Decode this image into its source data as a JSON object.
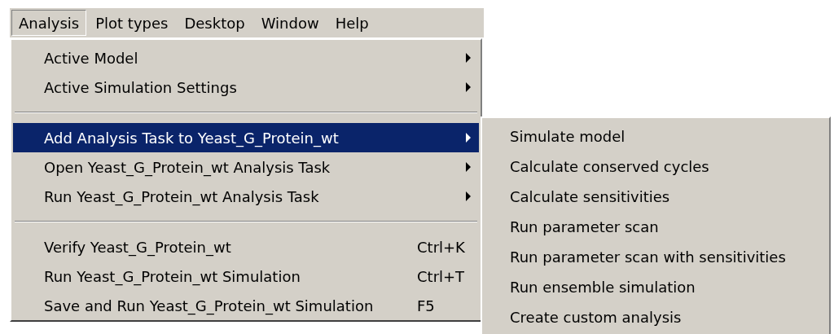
{
  "menubar": [
    {
      "label": "Analysis",
      "selected": true
    },
    {
      "label": "Plot types",
      "selected": false
    },
    {
      "label": "Desktop",
      "selected": false
    },
    {
      "label": "Window",
      "selected": false
    },
    {
      "label": "Help",
      "selected": false
    }
  ],
  "menu": {
    "groups": [
      [
        {
          "label": "Active Model",
          "submenu": true,
          "selected": false
        },
        {
          "label": "Active Simulation Settings",
          "submenu": true,
          "selected": false
        }
      ],
      [
        {
          "label": "Add Analysis Task to Yeast_G_Protein_wt",
          "submenu": true,
          "selected": true
        },
        {
          "label": "Open Yeast_G_Protein_wt Analysis Task",
          "submenu": true,
          "selected": false
        },
        {
          "label": "Run Yeast_G_Protein_wt Analysis Task",
          "submenu": true,
          "selected": false
        }
      ],
      [
        {
          "label": "Verify Yeast_G_Protein_wt",
          "shortcut": "Ctrl+K",
          "submenu": false,
          "selected": false
        },
        {
          "label": "Run Yeast_G_Protein_wt Simulation",
          "shortcut": "Ctrl+T",
          "submenu": false,
          "selected": false
        },
        {
          "label": "Save and Run Yeast_G_Protein_wt Simulation",
          "shortcut": "F5",
          "submenu": false,
          "selected": false
        }
      ]
    ]
  },
  "submenu": {
    "items": [
      {
        "label": "Simulate model"
      },
      {
        "label": "Calculate conserved cycles"
      },
      {
        "label": "Calculate sensitivities"
      },
      {
        "label": "Run parameter scan"
      },
      {
        "label": "Run parameter scan with sensitivities"
      },
      {
        "label": "Run ensemble simulation"
      },
      {
        "label": "Create custom analysis"
      }
    ]
  }
}
